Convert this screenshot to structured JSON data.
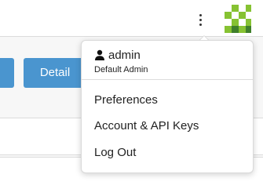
{
  "header": {
    "menu_icon": "vertical-ellipsis-icon",
    "logo_icon": "green-checker-logo"
  },
  "toolbar": {
    "detail_label": "Detail"
  },
  "user_menu": {
    "username": "admin",
    "role": "Default Admin",
    "items": [
      {
        "label": "Preferences"
      },
      {
        "label": "Account & API Keys"
      },
      {
        "label": "Log Out"
      }
    ]
  },
  "colors": {
    "button_blue": "#4a95cf",
    "logo_green": "#86c232",
    "logo_dark_green": "#3f7f2a"
  }
}
